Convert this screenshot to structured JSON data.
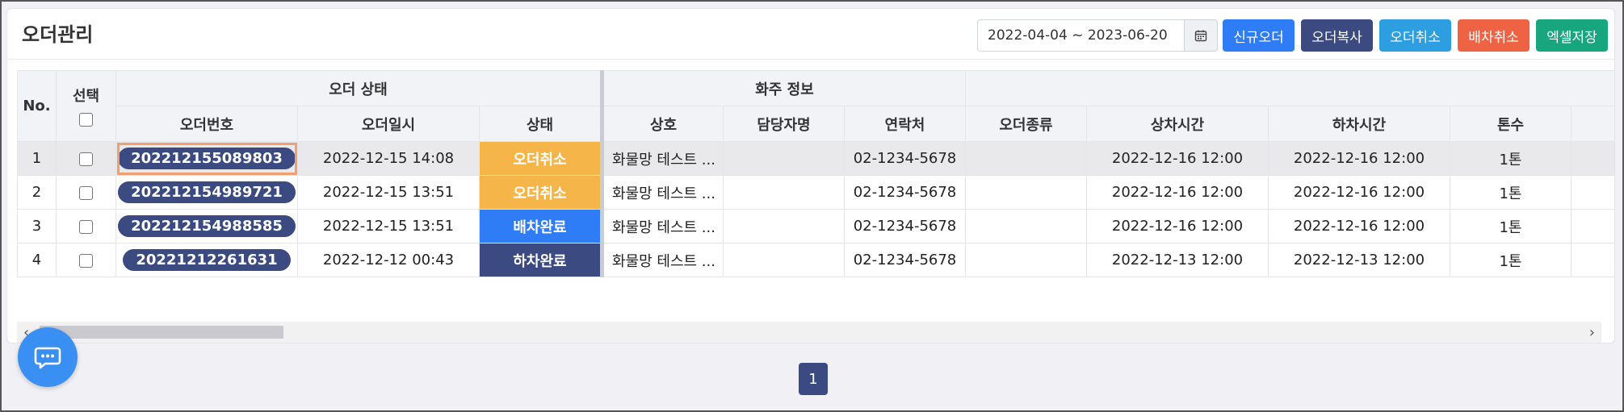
{
  "page": {
    "title": "오더관리"
  },
  "filter": {
    "date_range": "2022-04-04 ~ 2023-06-20"
  },
  "toolbar": {
    "buttons": [
      {
        "label": "신규오더",
        "color": "#2e7cf6"
      },
      {
        "label": "오더복사",
        "color": "#3b4a80"
      },
      {
        "label": "오더취소",
        "color": "#2d9ee0"
      },
      {
        "label": "배차취소",
        "color": "#ef6345"
      },
      {
        "label": "엑셀저장",
        "color": "#17a67e"
      }
    ]
  },
  "table": {
    "group_headers": {
      "order_status": "오더 상태",
      "shipper_info": "화주 정보"
    },
    "headers": {
      "no": "No.",
      "select": "선택",
      "order_no": "오더번호",
      "order_date": "오더일시",
      "status": "상태",
      "company": "상호",
      "manager": "담당자명",
      "contact": "연락처",
      "order_type": "오더종류",
      "load_time": "상차시간",
      "unload_time": "하차시간",
      "tonnage": "톤수"
    },
    "rows": [
      {
        "no": "1",
        "order_no": "20221215508980​3",
        "order_date": "2022-12-15 14:08",
        "status": "오더취소",
        "status_color": "#f5b548",
        "company": "화물망 테스트 ...",
        "manager": "",
        "contact": "02-1234-5678",
        "order_type": "",
        "load_time": "2022-12-16 12:00",
        "unload_time": "2022-12-16 12:00",
        "tonnage": "1톤"
      },
      {
        "no": "2",
        "order_no": "202212154989721",
        "order_date": "2022-12-15 13:51",
        "status": "오더취소",
        "status_color": "#f5b548",
        "company": "화물망 테스트 ...",
        "manager": "",
        "contact": "02-1234-5678",
        "order_type": "",
        "load_time": "2022-12-16 12:00",
        "unload_time": "2022-12-16 12:00",
        "tonnage": "1톤"
      },
      {
        "no": "3",
        "order_no": "202212154988585",
        "order_date": "2022-12-15 13:51",
        "status": "배차완료",
        "status_color": "#2e7cf6",
        "company": "화물망 테스트 ...",
        "manager": "",
        "contact": "02-1234-5678",
        "order_type": "",
        "load_time": "2022-12-16 12:00",
        "unload_time": "2022-12-16 12:00",
        "tonnage": "1톤"
      },
      {
        "no": "4",
        "order_no": "20221212261631",
        "order_date": "2022-12-12 00:43",
        "status": "하차완료",
        "status_color": "#3b4a80",
        "company": "화물망 테스트 ...",
        "manager": "",
        "contact": "02-1234-5678",
        "order_type": "",
        "load_time": "2022-12-13 12:00",
        "unload_time": "2022-12-13 12:00",
        "tonnage": "1톤"
      }
    ]
  },
  "pagination": {
    "current": "1"
  },
  "icons": {
    "calendar": "calendar-icon",
    "chat": "chat-icon",
    "left": "chevron-left-icon",
    "right": "chevron-right-icon"
  }
}
